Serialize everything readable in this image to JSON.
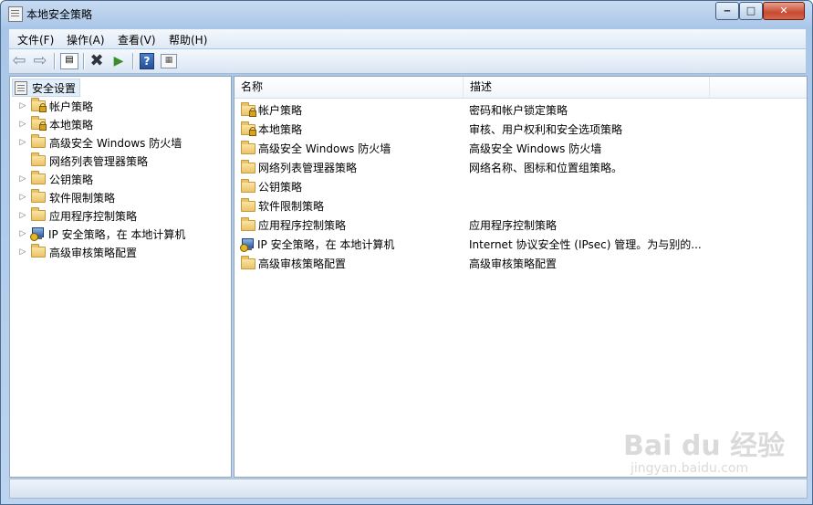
{
  "window": {
    "title": "本地安全策略"
  },
  "menu": [
    "文件(F)",
    "操作(A)",
    "查看(V)",
    "帮助(H)"
  ],
  "tree": {
    "root": "安全设置",
    "items": [
      {
        "label": "帐户策略",
        "icon": "folder-lock-icon",
        "expandable": true
      },
      {
        "label": "本地策略",
        "icon": "folder-lock-icon",
        "expandable": true
      },
      {
        "label": "高级安全 Windows 防火墙",
        "icon": "folder-icon",
        "expandable": true
      },
      {
        "label": "网络列表管理器策略",
        "icon": "folder-icon",
        "expandable": false
      },
      {
        "label": "公钥策略",
        "icon": "folder-icon",
        "expandable": true
      },
      {
        "label": "软件限制策略",
        "icon": "folder-icon",
        "expandable": true
      },
      {
        "label": "应用程序控制策略",
        "icon": "folder-icon",
        "expandable": true
      },
      {
        "label": "IP 安全策略，在 本地计算机",
        "icon": "ipsec-icon",
        "expandable": true
      },
      {
        "label": "高级审核策略配置",
        "icon": "folder-icon",
        "expandable": true
      }
    ]
  },
  "list": {
    "columns": [
      "名称",
      "描述"
    ],
    "rows": [
      {
        "name": "帐户策略",
        "desc": "密码和帐户锁定策略",
        "icon": "folder-lock-icon"
      },
      {
        "name": "本地策略",
        "desc": "审核、用户权利和安全选项策略",
        "icon": "folder-lock-icon"
      },
      {
        "name": "高级安全 Windows 防火墙",
        "desc": "高级安全 Windows 防火墙",
        "icon": "folder-icon"
      },
      {
        "name": "网络列表管理器策略",
        "desc": "网络名称、图标和位置组策略。",
        "icon": "folder-icon"
      },
      {
        "name": "公钥策略",
        "desc": "",
        "icon": "folder-icon"
      },
      {
        "name": "软件限制策略",
        "desc": "",
        "icon": "folder-icon"
      },
      {
        "name": "应用程序控制策略",
        "desc": "应用程序控制策略",
        "icon": "folder-icon"
      },
      {
        "name": "IP 安全策略，在 本地计算机",
        "desc": "Internet 协议安全性 (IPsec) 管理。为与别的...",
        "icon": "ipsec-icon"
      },
      {
        "name": "高级审核策略配置",
        "desc": "高级审核策略配置",
        "icon": "folder-icon"
      }
    ]
  },
  "watermark": {
    "main": "Bai du 经验",
    "sub": "jingyan.baidu.com"
  }
}
